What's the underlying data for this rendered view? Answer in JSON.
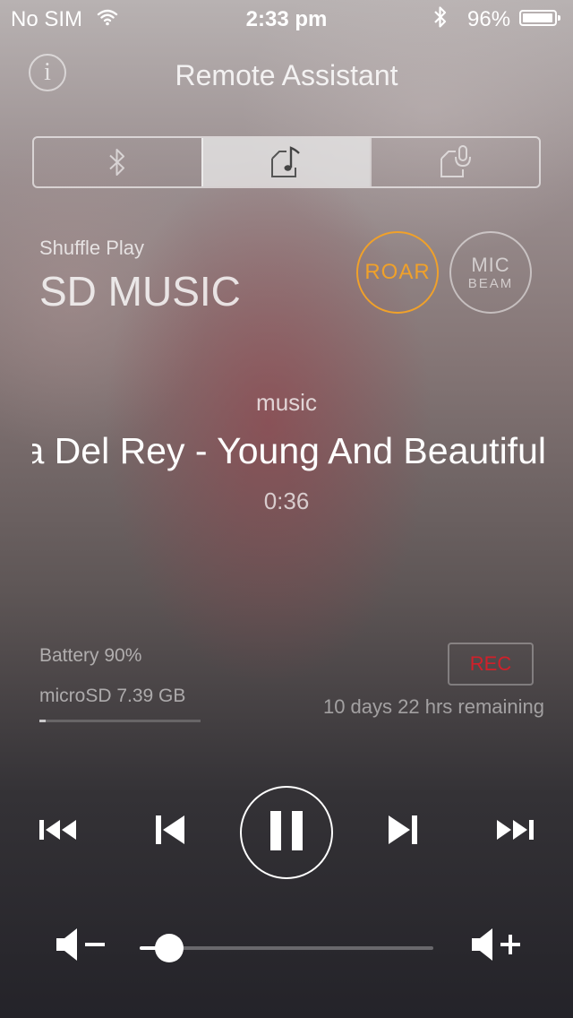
{
  "status_bar": {
    "carrier": "No SIM",
    "time": "2:33 pm",
    "battery_percent": "96%",
    "battery_level": 0.96,
    "icons": [
      "wifi-icon",
      "bluetooth-icon",
      "battery-icon"
    ]
  },
  "header": {
    "title": "Remote Assistant",
    "info_icon": "i"
  },
  "mode_tabs": [
    {
      "icon": "bluetooth-icon",
      "active": false
    },
    {
      "icon": "music-note-icon",
      "active": true
    },
    {
      "icon": "microphone-icon",
      "active": false
    }
  ],
  "source": {
    "mode": "Shuffle Play",
    "name": "SD MUSIC"
  },
  "sound_modes": {
    "roar_label": "ROAR",
    "mic_beam_line1": "MIC",
    "mic_beam_line2": "BEAM"
  },
  "now_playing": {
    "category": "music",
    "track": "na Del Rey - Young And Beautiful",
    "elapsed": "0:36"
  },
  "device": {
    "battery": "Battery 90%",
    "storage": "microSD 7.39 GB",
    "storage_used_fraction": 0.04,
    "rec_label": "REC",
    "remaining": "10 days  22 hrs remaining"
  },
  "transport": {
    "icons": [
      "fast-rewind-icon",
      "previous-track-icon",
      "pause-icon",
      "next-track-icon",
      "fast-forward-icon"
    ]
  },
  "volume": {
    "level": 0.1,
    "icons": [
      "volume-down-icon",
      "volume-up-icon"
    ]
  },
  "colors": {
    "roar_accent": "#f0a12a",
    "rec_red": "#d1202a"
  }
}
